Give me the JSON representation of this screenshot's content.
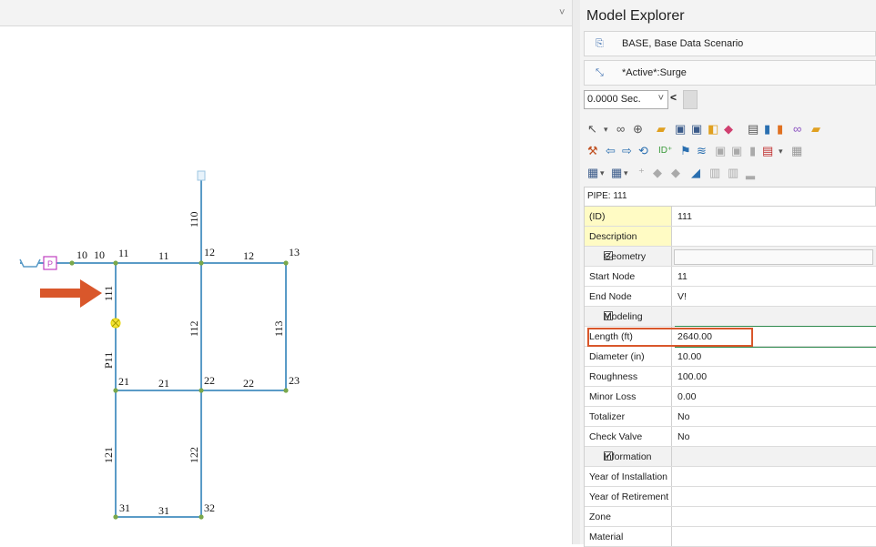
{
  "canvas": {
    "collapse_glyph": "˅",
    "nodes": [
      "10",
      "11",
      "12",
      "13",
      "21",
      "22",
      "23",
      "31",
      "32"
    ],
    "pipe_labels": {
      "p10": "10",
      "p11": "11",
      "p12": "12",
      "p110": "110",
      "p111": "111",
      "p112": "112",
      "p113": "113",
      "pP11": "P11",
      "p21": "21",
      "p22": "22",
      "p121": "121",
      "p122": "122",
      "p31": "31"
    },
    "node_labels": {
      "n11": "11",
      "n12": "12",
      "n13": "13",
      "n21": "21",
      "n22": "22",
      "n23": "23",
      "n31": "31",
      "n32": "32"
    },
    "colors": {
      "pipe": "#5a9bc7",
      "node": "#7aa84b",
      "arrow": "#d9572b",
      "valve": "#e6d300",
      "reservoir": "#c040c0"
    }
  },
  "panel": {
    "title": "Model Explorer",
    "scenario": "BASE, Base Data Scenario",
    "active": "*Active*:Surge",
    "time": "0.0000 Sec.",
    "time_dropdown": "˅",
    "time_prev": "<",
    "element_label": "PIPE: 111",
    "highlight_color": "#d9572b",
    "properties": [
      {
        "label": "(ID)",
        "value": "111",
        "kind": "yellow"
      },
      {
        "label": "Description",
        "value": "",
        "kind": "yellow"
      },
      {
        "label": "Geometry",
        "value": "",
        "kind": "cat"
      },
      {
        "label": "Start Node",
        "value": "11",
        "kind": "row"
      },
      {
        "label": "End Node",
        "value": "V!",
        "kind": "row"
      },
      {
        "label": "Modeling",
        "value": "",
        "kind": "cat"
      },
      {
        "label": "Length (ft)",
        "value": "2640.00",
        "kind": "row"
      },
      {
        "label": "Diameter (in)",
        "value": "10.00",
        "kind": "row"
      },
      {
        "label": "Roughness",
        "value": "100.00",
        "kind": "row"
      },
      {
        "label": "Minor Loss",
        "value": "0.00",
        "kind": "row"
      },
      {
        "label": "Totalizer",
        "value": "No",
        "kind": "row"
      },
      {
        "label": "Check Valve",
        "value": "No",
        "kind": "row"
      },
      {
        "label": "Information",
        "value": "",
        "kind": "cat"
      },
      {
        "label": "Year of Installation",
        "value": "",
        "kind": "row"
      },
      {
        "label": "Year of Retirement",
        "value": "",
        "kind": "row"
      },
      {
        "label": "Zone",
        "value": "",
        "kind": "row"
      },
      {
        "label": "Material",
        "value": "",
        "kind": "row"
      }
    ]
  }
}
